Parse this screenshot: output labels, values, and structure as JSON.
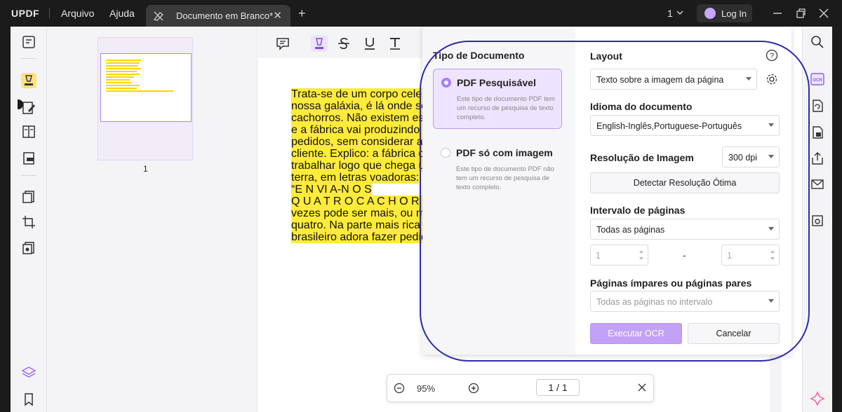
{
  "titlebar": {
    "logo": "UPDF",
    "menu": [
      "Arquivo",
      "Ajuda"
    ],
    "tab_label": "Documento em Branco*",
    "page_count": "1",
    "login_label": "Log In"
  },
  "document": {
    "lines": [
      "Trata-se de um corpo celeste",
      "nossa galáxia, é lá onde se fab",
      "cachorros. Não existem estoq",
      "e a fábrica vai produzindo con",
      "pedidos, sem considerar a vor",
      "cliente. Explico: a fábrica come",
      "trabalhar logo que chega um",
      "terra, em letras voadoras:",
      "“E N VI A-N O S",
      "Q U A T R O C A C H O R R O",
      "vezes pode ser mais, ou meno",
      "quatro. Na parte mais rica do",
      "brasileiro adora fazer pedido"
    ],
    "highlight_color": "#ffeb3b"
  },
  "thumbnail": {
    "page_number": "1"
  },
  "bottombar": {
    "zoom": "95%",
    "page": "1 / 1"
  },
  "ocr": {
    "doc_type_title": "Tipo de Documento",
    "opt1_title": "PDF Pesquisável",
    "opt1_desc": "Este tipo de documento PDF tem um recurso de pesquisa de texto completo.",
    "opt2_title": "PDF só com imagem",
    "opt2_desc": "Este tipo de documento PDF não tem um recurso de pesquisa de texto completo.",
    "layout_title": "Layout",
    "layout_value": "Texto sobre a imagem da página",
    "language_title": "Idioma do documento",
    "language_value": "English-Inglês,Portuguese-Português",
    "resolution_title": "Resolução de Imagem",
    "resolution_value": "300 dpi",
    "detect_button": "Detectar Resolução Ótima",
    "range_title": "Intervalo de páginas",
    "range_value": "Todas as páginas",
    "range_from": "1",
    "range_dash": "-",
    "range_to": "1",
    "oddeven_title": "Páginas ímpares ou páginas pares",
    "oddeven_value": "Todas as páginas no intervalo",
    "run_button": "Executar OCR",
    "cancel_button": "Cancelar",
    "accent_color": "#a67dfb"
  }
}
